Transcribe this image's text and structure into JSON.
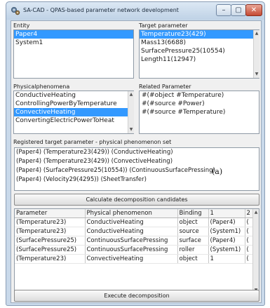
{
  "window": {
    "title": "SA-CAD - QPAS-based parameter network development",
    "min_glyph": "–",
    "max_glyph": "▢",
    "close_glyph": "✕"
  },
  "entity": {
    "label": "Entity",
    "items": [
      {
        "text": "Paper4",
        "selected": true
      },
      {
        "text": "System1",
        "selected": false
      }
    ]
  },
  "target_parameter": {
    "label": "Target parameter",
    "items": [
      {
        "text": "Temperature23(429)",
        "selected": true
      },
      {
        "text": "Mass13(6688)",
        "selected": false
      },
      {
        "text": "SurfacePressure25(10554)",
        "selected": false
      },
      {
        "text": "Length11(12947)",
        "selected": false
      }
    ]
  },
  "physical_phenomena": {
    "label": "Physicalphenomena",
    "items": [
      {
        "text": "ConductiveHeating",
        "selected": false
      },
      {
        "text": "ControllingPowerByTemperature",
        "selected": false
      },
      {
        "text": "ConvectiveHeating",
        "selected": true
      },
      {
        "text": "ConvertingElectricPowerToHeat",
        "selected": false
      }
    ]
  },
  "related_parameter": {
    "label": "Related Parameter",
    "items": [
      {
        "text": "#(#object #Temperature)",
        "selected": false
      },
      {
        "text": "#(#source #Power)",
        "selected": false
      },
      {
        "text": "#(#source #Temperature)",
        "selected": false
      }
    ]
  },
  "registered": {
    "label": "Registered target parameter - physical phenomenon set",
    "lines": [
      "(Paper4) (Temperature23(429)) (ConductiveHeating)",
      "(Paper4) (Temperature23(429)) (ConvectiveHeating)",
      "(Paper4) (SurfacePressure25(10554)) (ContinuousSurfacePressing)",
      "(Paper4) (Velocity29(4295)) (SheetTransfer)"
    ],
    "annotation": "(a)"
  },
  "calculate_button_label": "Calculate decomposition candidates",
  "candidates_table": {
    "columns": [
      "Parameter",
      "Physical phenomenon",
      "Binding",
      "1",
      "2"
    ],
    "rows": [
      [
        "(Temperature23)",
        "ConductiveHeating",
        "object",
        "(Paper4)",
        "("
      ],
      [
        "(Temperature23)",
        "ConductiveHeating",
        "source",
        "(System1)",
        "("
      ],
      [
        "(SurfacePressure25)",
        "ContinuousSurfacePressing",
        "surface",
        "(Paper4)",
        "("
      ],
      [
        "(SurfacePressure25)",
        "ContinuousSurfacePressing",
        "roller",
        "(System1)",
        "("
      ],
      [
        "(Temperature23)",
        "ConvectiveHeating",
        "object",
        "1",
        "("
      ]
    ]
  },
  "execute_button_label": "Execute decomposition",
  "colors": {
    "selection": "#3399ff",
    "window_frame": "#c9d9ea",
    "client_bg": "#f0f0f0"
  },
  "icons": {
    "app": "gear-cluster-icon",
    "scroll_up": "triangle-up-icon",
    "scroll_down": "triangle-down-icon",
    "scroll_left": "triangle-left-icon",
    "scroll_right": "triangle-right-icon"
  }
}
